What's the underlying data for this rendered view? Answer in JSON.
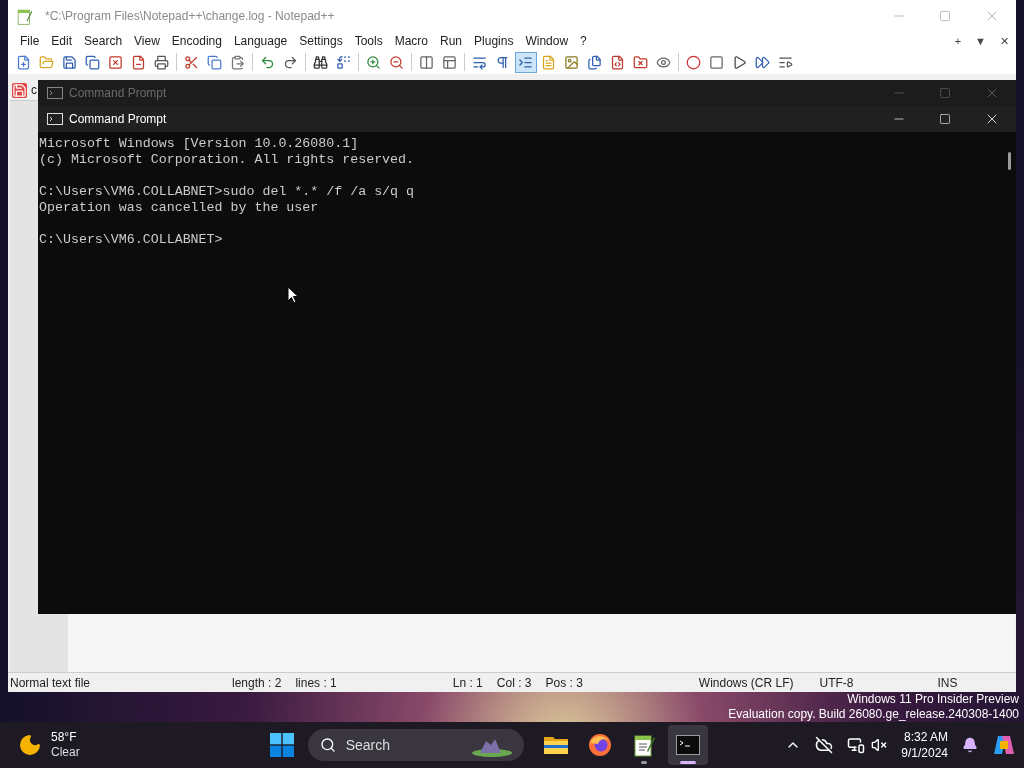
{
  "notepad": {
    "title": "*C:\\Program Files\\Notepad++\\change.log - Notepad++",
    "menu": [
      "File",
      "Edit",
      "Search",
      "View",
      "Encoding",
      "Language",
      "Settings",
      "Tools",
      "Macro",
      "Run",
      "Plugins",
      "Window",
      "?"
    ],
    "menu_right": [
      "+",
      "▼",
      "✕"
    ],
    "toolbar": [
      {
        "selected": false
      },
      {
        "selected": false
      },
      {
        "selected": false
      },
      {
        "selected": false
      },
      {
        "selected": false
      },
      {
        "selected": false
      },
      {
        "selected": false
      },
      {
        "selected": false
      },
      {
        "selected": false
      },
      {
        "selected": false
      },
      {
        "selected": false
      },
      {
        "selected": false
      },
      {
        "selected": false
      },
      {
        "selected": false
      },
      {
        "selected": false
      },
      {
        "selected": false
      },
      {
        "selected": false
      },
      {
        "selected": false
      },
      {
        "selected": false
      },
      {
        "selected": false
      },
      {
        "selected": true
      },
      {
        "selected": false
      },
      {
        "selected": false
      },
      {
        "selected": false
      },
      {
        "selected": false
      },
      {
        "selected": false
      },
      {
        "selected": false
      },
      {
        "selected": false
      },
      {
        "selected": false
      },
      {
        "selected": false
      },
      {
        "selected": false
      },
      {
        "selected": false
      }
    ],
    "tab": {
      "label": "c"
    },
    "status_bar": [
      {
        "text": "Normal text file",
        "kind": "wide"
      },
      {
        "text": "length : 2",
        "kind": "group"
      },
      {
        "text": "lines : 1",
        "kind": "wide"
      },
      {
        "text": "Ln : 1",
        "kind": "group"
      },
      {
        "text": "Col : 3",
        "kind": "group"
      },
      {
        "text": "Pos : 3",
        "kind": "wide"
      },
      {
        "text": "Windows (CR LF)",
        "kind": "mid"
      },
      {
        "text": "UTF-8",
        "kind": "mid"
      },
      {
        "text": "INS",
        "kind": "end"
      }
    ]
  },
  "background_window": {
    "title": "Command Prompt"
  },
  "console": {
    "title": "Command Prompt",
    "blocks": [
      [
        "Microsoft Windows [Version 10.0.26080.1]",
        "(c) Microsoft Corporation. All rights reserved."
      ],
      [
        "C:\\Users\\VM6.COLLABNET>sudo del *.* /f /a s/q q",
        "Operation was cancelled by the user"
      ],
      [
        "C:\\Users\\VM6.COLLABNET>"
      ]
    ]
  },
  "desktop_watermark": [
    "Windows 11 Pro Insider Preview",
    "Evaluation copy. Build 26080.ge_release.240308-1400"
  ],
  "taskbar": {
    "weather": {
      "temperature": "58°F",
      "condition": "Clear"
    },
    "search": {
      "placeholder": "Search"
    },
    "apps": [
      {
        "kind": "explorer",
        "running": false,
        "selected": false
      },
      {
        "kind": "firefox",
        "running": false,
        "selected": false
      },
      {
        "kind": "notepad",
        "running": true,
        "selected": false
      },
      {
        "kind": "terminal",
        "running": true,
        "selected": true
      }
    ],
    "clock": {
      "time": "8:32 AM",
      "date": "9/1/2024"
    }
  }
}
